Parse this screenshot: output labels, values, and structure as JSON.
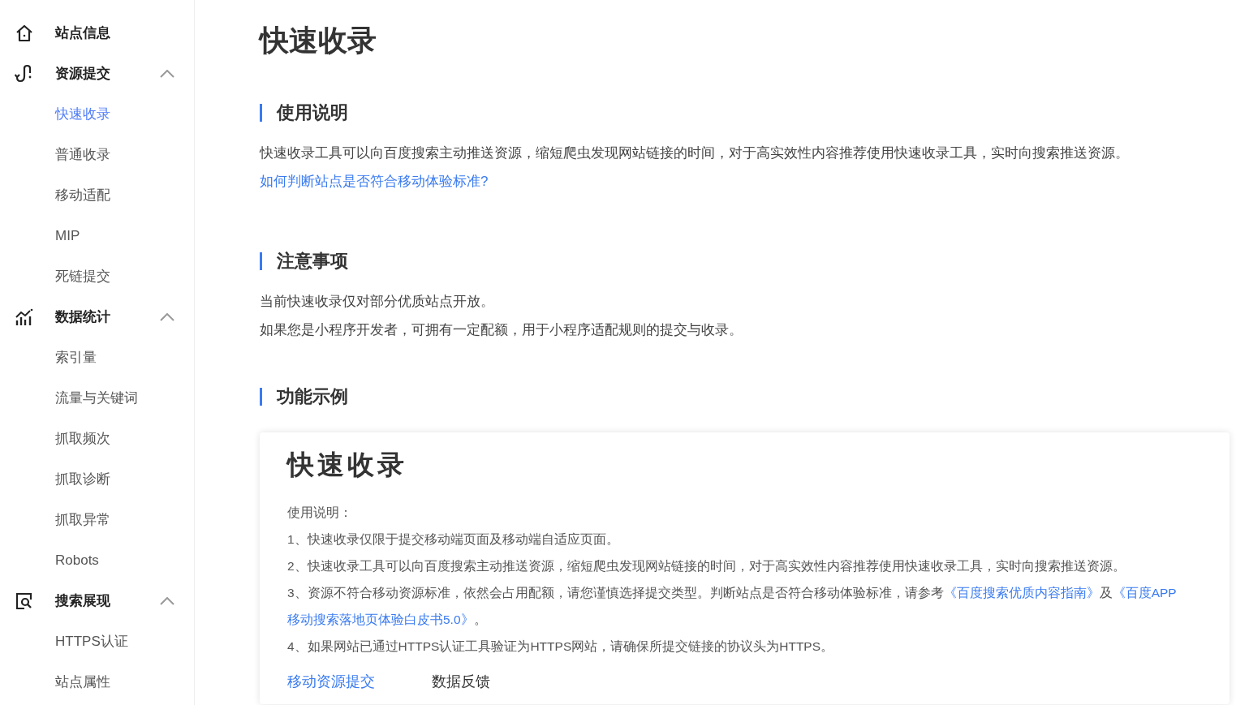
{
  "sidebar": {
    "groups": [
      {
        "kind": "home",
        "label": "站点信息",
        "expanded": false
      },
      {
        "kind": "submit",
        "label": "资源提交",
        "expanded": true,
        "items": [
          {
            "label": "快速收录",
            "selected": true
          },
          {
            "label": "普通收录",
            "selected": false
          },
          {
            "label": "移动适配",
            "selected": false
          },
          {
            "label": "MIP",
            "selected": false
          },
          {
            "label": "死链提交",
            "selected": false
          }
        ]
      },
      {
        "kind": "stats",
        "label": "数据统计",
        "expanded": true,
        "items": [
          {
            "label": "索引量",
            "selected": false
          },
          {
            "label": "流量与关键词",
            "selected": false
          },
          {
            "label": "抓取频次",
            "selected": false
          },
          {
            "label": "抓取诊断",
            "selected": false
          },
          {
            "label": "抓取异常",
            "selected": false
          },
          {
            "label": "Robots",
            "selected": false
          }
        ]
      },
      {
        "kind": "search",
        "label": "搜索展现",
        "expanded": true,
        "items": [
          {
            "label": "HTTPS认证",
            "selected": false
          },
          {
            "label": "站点属性",
            "selected": false
          }
        ]
      }
    ]
  },
  "main": {
    "title": "快速收录",
    "sections": [
      {
        "heading": "使用说明",
        "lines": [
          {
            "kind": "text",
            "text": "快速收录工具可以向百度搜索主动推送资源，缩短爬虫发现网站链接的时间，对于高实效性内容推荐使用快速收录工具，实时向搜索推送资源。"
          },
          {
            "kind": "link",
            "text": "如何判断站点是否符合移动体验标准?"
          }
        ]
      },
      {
        "heading": "注意事项",
        "lines": [
          {
            "kind": "text",
            "text": "当前快速收录仅对部分优质站点开放。"
          },
          {
            "kind": "text",
            "text": "如果您是小程序开发者，可拥有一定配额，用于小程序适配规则的提交与收录。"
          }
        ]
      },
      {
        "heading": "功能示例"
      }
    ],
    "example": {
      "title": "快速收录",
      "intro": "使用说明：",
      "paragraphs": [
        [
          {
            "kind": "text",
            "text": "1、快速收录仅限于提交移动端页面及移动端自适应页面。"
          }
        ],
        [
          {
            "kind": "text",
            "text": "2、快速收录工具可以向百度搜索主动推送资源，缩短爬虫发现网站链接的时间，对于高实效性内容推荐使用快速收录工具，实时向搜索推送资源。"
          }
        ],
        [
          {
            "kind": "text",
            "text": "3、资源不符合移动资源标准，依然会占用配额，请您谨慎选择提交类型。判断站点是否符合移动体验标准，请参考"
          },
          {
            "kind": "link",
            "text": "《百度搜索优质内容指南》"
          },
          {
            "kind": "text",
            "text": "及"
          },
          {
            "kind": "link",
            "text": "《百度APP"
          },
          {
            "kind": "link",
            "text": "移动搜索落地页体验白皮书5.0》"
          },
          {
            "kind": "text",
            "text": "。"
          }
        ],
        [
          {
            "kind": "text",
            "text": "4、如果网站已通过HTTPS认证工具验证为HTTPS网站，请确保所提交链接的协议头为HTTPS。"
          }
        ]
      ],
      "tabs": [
        {
          "label": "移动资源提交",
          "selected": true
        },
        {
          "label": "数据反馈",
          "selected": false
        }
      ]
    }
  }
}
